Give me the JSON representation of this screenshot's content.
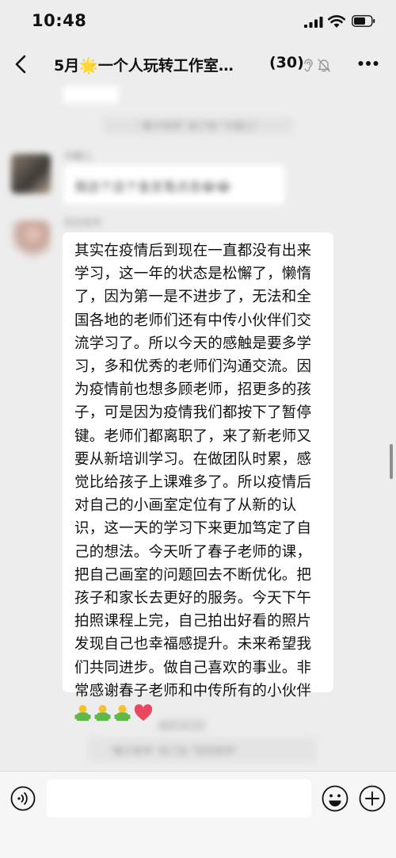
{
  "status": {
    "time": "10:48"
  },
  "header": {
    "title": "5月🌟一个人玩转工作室…",
    "count": "(30)"
  },
  "history": {
    "system_message_1": "\"春子老师\" 拍了拍 \"卡薇儿\"",
    "sender_1": "卡薇儿",
    "message_1": "我这个这个金支笔点击😂😂",
    "sender_2": "范范老师",
    "timestamp": "昨天 21:53",
    "system_message_2": "\"春子老师\" 拍了拍 \"范范老师\""
  },
  "message": {
    "text": "其实在疫情后到现在一直都没有出来学习，这一年的状态是松懈了，懒惰了，因为第一是不进步了，无法和全国各地的老师们还有中传小伙伴们交流学习了。所以今天的感触是要多学习，多和优秀的老师们沟通交流。因为疫情前也想多顾老师，招更多的孩子，可是因为疫情我们都按下了暂停键。老师们都离职了，来了新老师又要从新培训学习。在做团队时累，感觉比给孩子上课难多了。所以疫情后对自己的小画室定位有了从新的认识，这一天的学习下来更加笃定了自己的想法。今天听了春子老师的课，把自己画室的问题回去不断优化。把孩子和家长去更好的服务。今天下午拍照课程上完，自己拍出好看的照片发现自己也幸福感提升。未来希望我们共同进步。做自己喜欢的事业。非常感谢春子老师和中传所有的小伙伴",
    "emoji_icons": [
      "person-icon",
      "person-icon",
      "person-icon",
      "heart-icon"
    ]
  },
  "input": {
    "placeholder": ""
  },
  "colors": {
    "background": "#ededed",
    "bubble": "#ffffff",
    "heart": "#e8475f",
    "person_head": "#f5c22b",
    "person_body": "#5fb847"
  }
}
